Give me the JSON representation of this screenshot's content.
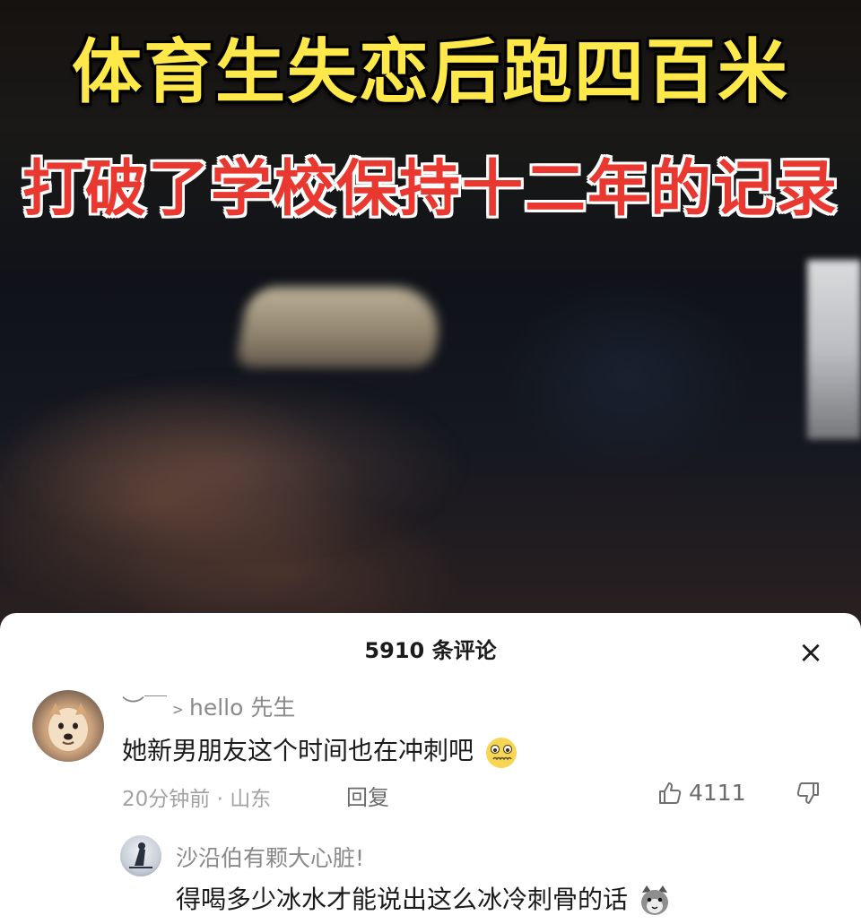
{
  "video": {
    "headline_line1": "体育生失恋后跑四百米",
    "headline_line2": "打破了学校保持十二年的记录",
    "headline_line1_color": "#ffe84a",
    "headline_line2_color": "#e8382f"
  },
  "comments_panel": {
    "title": "5910 条评论",
    "close_label": "×",
    "comments": [
      {
        "username": "︶￣﹥hello 先生",
        "text": "她新男朋友这个时间也在冲刺吧",
        "emoji": "shy-face-emoji",
        "time_location": "20分钟前 · 山东",
        "reply_label": "回复",
        "like_count": "4111"
      },
      {
        "username": "沙沿伯有颗大心脏!",
        "text": "得喝多少冰水才能说出这么冰冷刺骨的话",
        "emoji": "cat-face-emoji"
      }
    ]
  },
  "icons": {
    "like": "thumbs-up-icon",
    "dislike": "thumbs-down-icon",
    "close": "close-icon"
  }
}
